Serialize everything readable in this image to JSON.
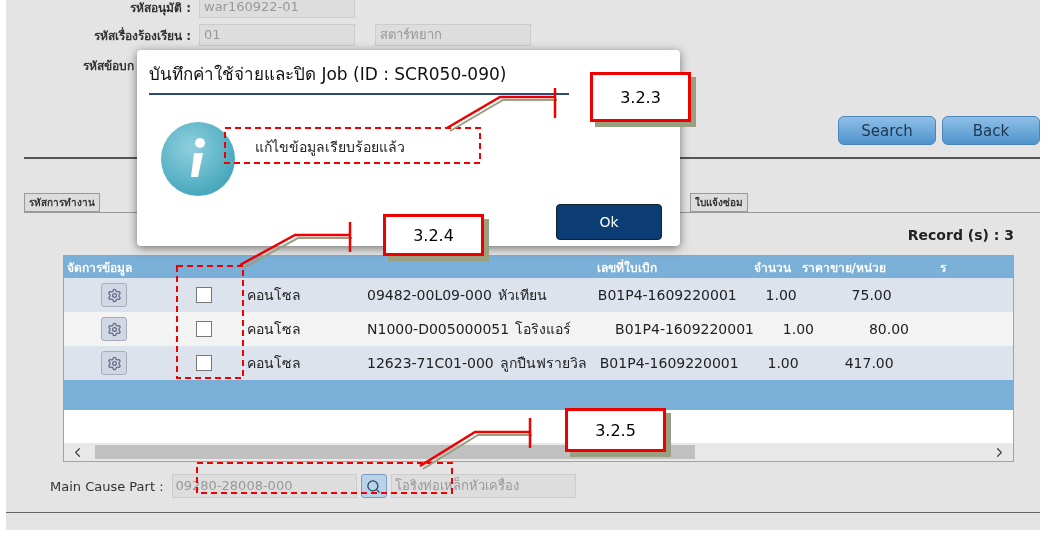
{
  "form": {
    "fields": [
      {
        "label": "รหัสอนุมัติ :",
        "value": "war160922-01"
      },
      {
        "label": "รหัสเรื่องร้องเรียน :",
        "value": "01",
        "extra": "สตาร์ทยาก"
      },
      {
        "label": "รหัสข้อบก"
      }
    ],
    "buttons": [
      "Search",
      "Back"
    ]
  },
  "tabs": [
    {
      "label": "รหัสการทำงาน"
    },
    {
      "label": "ใบแจ้งซ่อม"
    }
  ],
  "record_count": "Record (s) : 3",
  "table": {
    "columns": [
      {
        "label": "จัดการข้อมูล"
      },
      {},
      {},
      {},
      {},
      {
        "label": "เลขที่ใบเบิก"
      },
      {
        "label": "จำนวน"
      },
      {
        "label": "ราคาขาย/หน่วย"
      },
      {
        "label": "ร"
      }
    ],
    "rows": [
      {
        "checked": false,
        "cells": [
          "",
          "",
          "คอนโซล",
          "09482-00L09-000",
          "หัวเทียน",
          "B01P4-1609220001",
          "1.00",
          "75.00"
        ]
      },
      {
        "checked": false,
        "cells": [
          "",
          "",
          "คอนโซล",
          "N1000-D005000051",
          "โอริงแอร์",
          "B01P4-1609220001",
          "1.00",
          "80.00"
        ]
      },
      {
        "checked": false,
        "cells": [
          "",
          "",
          "คอนโซล",
          "12623-71C01-000",
          "ลูกปืนฟรายวิล",
          "B01P4-1609220001",
          "1.00",
          "417.00"
        ]
      }
    ]
  },
  "main_cause": {
    "label": "Main Cause Part :",
    "code": "09280-28008-000",
    "name": "โอริงท่อเหล็กหัวเครื่อง"
  },
  "dialog": {
    "title": "บันทึกค่าใช้จ่ายและปิด Job (ID : SCR050-090)",
    "message": "แก้ไขข้อมูลเรียบร้อยแล้ว",
    "button": "Ok"
  },
  "annotations": [
    {
      "label": "3.2.3"
    },
    {
      "label": "3.2.4"
    },
    {
      "label": "3.2.5"
    }
  ]
}
